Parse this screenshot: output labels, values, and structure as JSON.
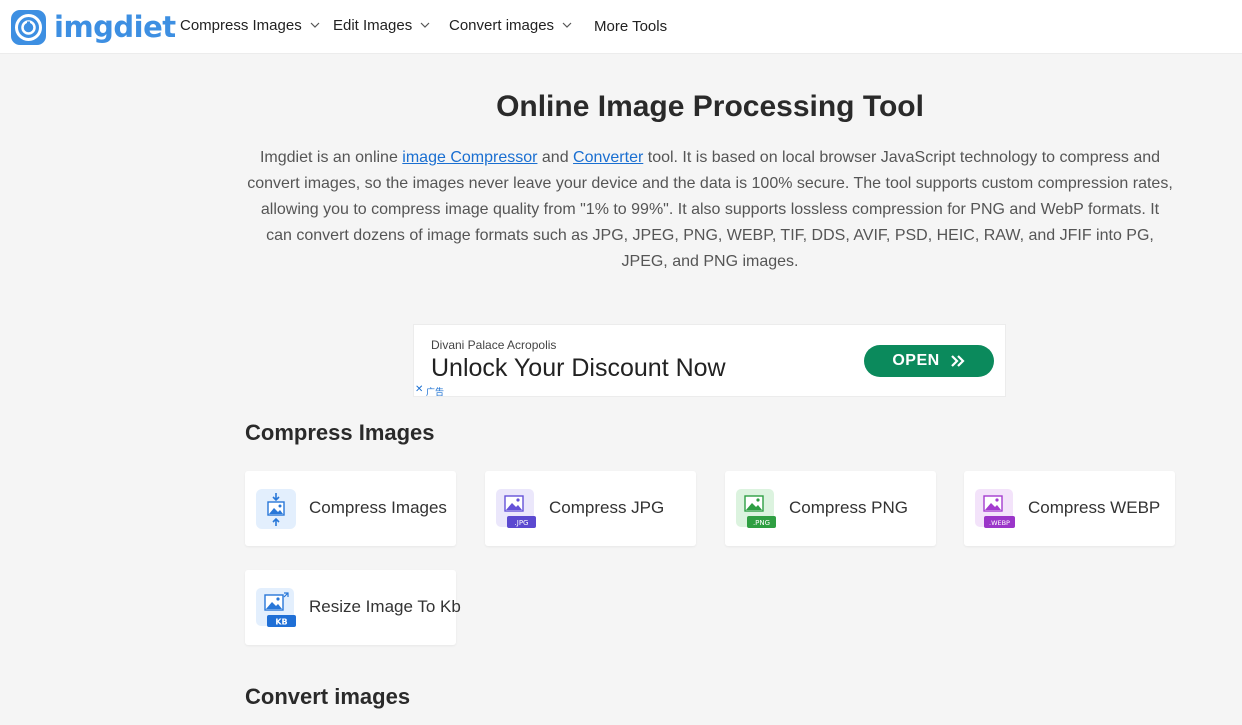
{
  "brand": {
    "name": "imgdiet",
    "color": "#3d8fe2"
  },
  "nav": [
    {
      "label": "Compress Images",
      "has_dropdown": true
    },
    {
      "label": "Edit Images",
      "has_dropdown": true
    },
    {
      "label": "Convert images",
      "has_dropdown": true
    },
    {
      "label": "More Tools",
      "has_dropdown": false
    }
  ],
  "hero": {
    "title": "Online Image Processing Tool",
    "intro_part1": "Imgdiet is an online ",
    "link1": "image Compressor",
    "intro_part2": " and ",
    "link2": "Converter",
    "intro_part3": " tool. It is based on local browser JavaScript technology to compress and convert images, so the images never leave your device and the data is 100% secure. The tool supports custom compression rates, allowing you to compress image quality from \"1% to 99%\". It also supports lossless compression for PNG and WebP formats. It can convert dozens of image formats such as JPG, JPEG, PNG, WEBP, TIF, DDS, AVIF, PSD, HEIC, RAW, and JFIF into PG, JPEG, and PNG images."
  },
  "ad": {
    "advertiser": "Divani Palace Acropolis",
    "headline": "Unlock Your Discount Now",
    "button": "OPEN",
    "close": "✕",
    "tag": "广告",
    "button_color": "#0b8a5c"
  },
  "sections": {
    "compress": {
      "title": "Compress Images",
      "cards": [
        {
          "label": "Compress Images",
          "icon": "compress-image-icon"
        },
        {
          "label": "Compress JPG",
          "icon": "jpg-image-icon",
          "badge": ".JPG"
        },
        {
          "label": "Compress PNG",
          "icon": "png-image-icon",
          "badge": ".PNG"
        },
        {
          "label": "Compress WEBP",
          "icon": "webp-image-icon",
          "badge": ".WEBP"
        },
        {
          "label": "Resize Image To Kb",
          "icon": "kb-image-icon",
          "badge": "KB"
        }
      ]
    },
    "convert": {
      "title": "Convert images"
    }
  }
}
